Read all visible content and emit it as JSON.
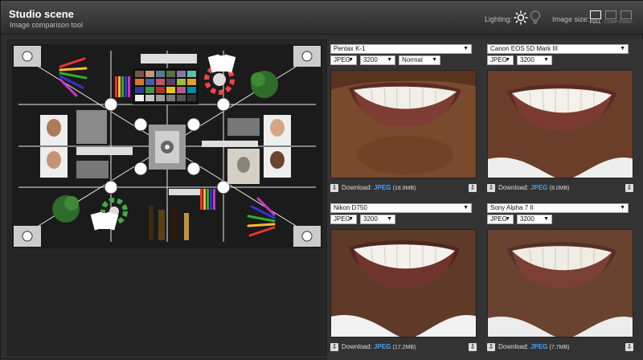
{
  "header": {
    "title": "Studio scene",
    "subtitle": "Image comparison tool",
    "lighting_label": "Lighting:",
    "image_size_label": "Image size:",
    "size_options": [
      {
        "label": "FULL",
        "active": true
      },
      {
        "label": "COMP",
        "active": false
      },
      {
        "label": "PRINT",
        "active": false
      }
    ]
  },
  "cameras": [
    {
      "camera": "Pentax K-1",
      "format": "JPEG",
      "iso": "3200",
      "mode": "Normal",
      "download_label": "Download:",
      "download_link": "JPEG",
      "download_size": "(18.9MB)"
    },
    {
      "camera": "Canon EOS 5D Mark III",
      "format": "JPEG",
      "iso": "3200",
      "mode": null,
      "download_label": "Download:",
      "download_link": "JPEG",
      "download_size": "(8.0MB)"
    },
    {
      "camera": "Nikon D750",
      "format": "JPEG",
      "iso": "3200",
      "mode": null,
      "download_label": "Download:",
      "download_link": "JPEG",
      "download_size": "(17.2MB)"
    },
    {
      "camera": "Sony Alpha 7 II",
      "format": "JPEG",
      "iso": "3200",
      "mode": null,
      "download_label": "Download:",
      "download_link": "JPEG",
      "download_size": "(7.7MB)"
    }
  ],
  "icons": {
    "lighting_daylight": "sun-icon",
    "lighting_tungsten": "bulb-icon",
    "download": "download-icon"
  }
}
